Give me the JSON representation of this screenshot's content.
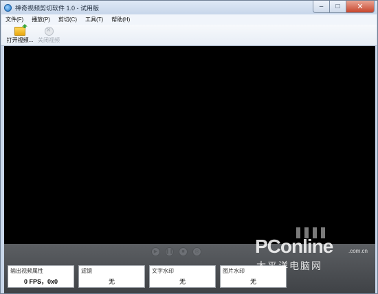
{
  "window": {
    "title": "神奇视频剪切软件 1.0 - 试用版",
    "controls": {
      "minimize": "–",
      "maximize": "□",
      "close": "✕"
    }
  },
  "menu": [
    "文件(F)",
    "播放(P)",
    "剪切(C)",
    "工具(T)",
    "帮助(H)"
  ],
  "toolbar": {
    "open_video": {
      "label": "打开视频...",
      "icon": "folder-open-icon"
    },
    "close_video": {
      "label": "关闭视频",
      "icon": "close-circle-icon",
      "disabled": true
    }
  },
  "playback_controls": [
    {
      "name": "play-icon"
    },
    {
      "name": "pause-icon"
    },
    {
      "name": "stop-icon"
    },
    {
      "name": "screenshot-icon"
    }
  ],
  "cards": [
    {
      "title": "输出视频属性",
      "value": "0 FPS，0x0"
    },
    {
      "title": "滤镜",
      "value": "无"
    },
    {
      "title": "文字水印",
      "value": "无"
    },
    {
      "title": "图片水印",
      "value": "无"
    }
  ],
  "watermark": {
    "logo": "PConline",
    "domain": ".com.cn",
    "cn": "太平洋电脑网"
  },
  "colors": {
    "video_bg": "#000000",
    "panel_bg": "#4a4d51",
    "titlebar": "#c7d6ea",
    "close_button": "#c7452c"
  }
}
